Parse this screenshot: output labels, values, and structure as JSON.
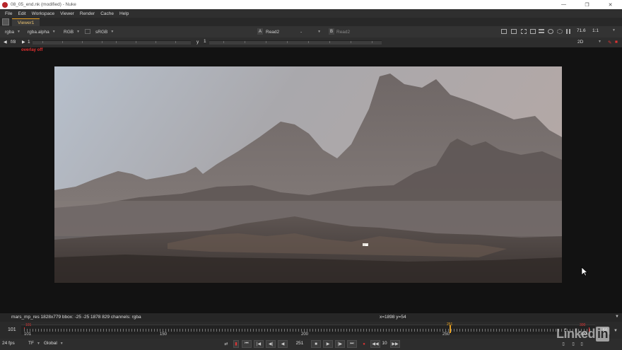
{
  "window": {
    "title": "08_05_end.nk (modified) - Nuke",
    "controls": [
      "—",
      "❐",
      "✕"
    ]
  },
  "menu": [
    "File",
    "Edit",
    "Workspace",
    "Viewer",
    "Render",
    "Cache",
    "Help"
  ],
  "tabs": [
    "Viewer1"
  ],
  "toolbar": {
    "channels": "rgba",
    "alpha": "rgba.alpha",
    "display": "RGB",
    "colorspace": "sRGB",
    "a_label": "A",
    "a_input": "Read2",
    "op": "-",
    "b_label": "B",
    "b_input": "Read2",
    "zoom": "71.6",
    "scale": "1:1"
  },
  "toolbar2": {
    "fstop": "f/8",
    "gain": "1",
    "y_label": "y",
    "gamma": "1",
    "view_mode": "2D"
  },
  "viewer": {
    "overlay_label": "overlay off"
  },
  "info": {
    "left": "mars_mp_res 1828x779  bbox: -25 -25 1878 829 channels: rgba",
    "coords": "x=1898 y=54"
  },
  "timeline": {
    "current_frame": "101",
    "in_point": "101",
    "out_point": "300",
    "labels": [
      "101",
      "150",
      "200",
      "250",
      "300"
    ],
    "cursor_frame": "251",
    "right_box": "50"
  },
  "controls": {
    "fps": "24 fps",
    "tf": "TF",
    "scope": "Global",
    "frame": "251",
    "increment": "10"
  },
  "watermark": {
    "text": "Linked",
    "suffix": "in"
  }
}
